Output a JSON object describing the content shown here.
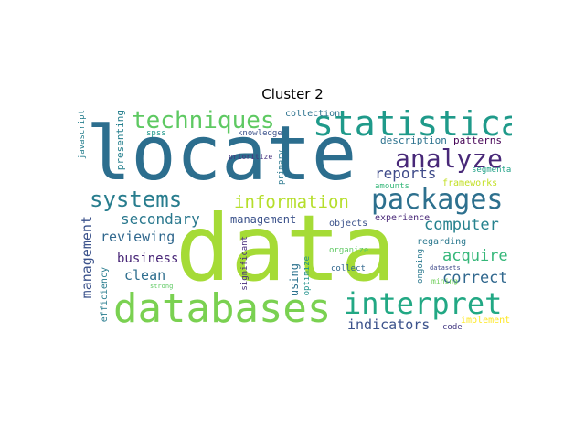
{
  "title": "Cluster 2",
  "words": [
    {
      "text": "data",
      "color": "#a5db36"
    },
    {
      "text": "locate",
      "color": "#2c6e8e"
    },
    {
      "text": "databases",
      "color": "#7ad151"
    },
    {
      "text": "statistical",
      "color": "#1f9a8a"
    },
    {
      "text": "interpret",
      "color": "#22a884"
    },
    {
      "text": "packages",
      "color": "#2d708e"
    },
    {
      "text": "techniques",
      "color": "#5ec962"
    },
    {
      "text": "analyze",
      "color": "#482878"
    },
    {
      "text": "systems",
      "color": "#287d8e"
    },
    {
      "text": "information",
      "color": "#b5de2b"
    },
    {
      "text": "computer",
      "color": "#26828e"
    },
    {
      "text": "reports",
      "color": "#3e4a89"
    },
    {
      "text": "acquire",
      "color": "#35b779"
    },
    {
      "text": "secondary",
      "color": "#2a788e"
    },
    {
      "text": "reviewing",
      "color": "#31688e"
    },
    {
      "text": "correct",
      "color": "#31688e"
    },
    {
      "text": "business",
      "color": "#482677"
    },
    {
      "text": "clean",
      "color": "#2e6e8e"
    },
    {
      "text": "indicators",
      "color": "#3b528b"
    },
    {
      "text": "management",
      "color": "#3b528b"
    },
    {
      "text": "description",
      "color": "#2c728e"
    },
    {
      "text": "patterns",
      "color": "#440154"
    },
    {
      "text": "frameworks",
      "color": "#c2df23"
    },
    {
      "text": "segmentation",
      "color": "#1fa187"
    },
    {
      "text": "regarding",
      "color": "#2a788e"
    },
    {
      "text": "experience",
      "color": "#482878"
    },
    {
      "text": "objects",
      "color": "#3b528b"
    },
    {
      "text": "amounts",
      "color": "#35b779"
    },
    {
      "text": "organize",
      "color": "#5ec962"
    },
    {
      "text": "collect",
      "color": "#31688e"
    },
    {
      "text": "mining",
      "color": "#6ece58"
    },
    {
      "text": "datasets",
      "color": "#3e4989"
    },
    {
      "text": "implement",
      "color": "#fde725"
    },
    {
      "text": "code",
      "color": "#443983"
    },
    {
      "text": "collection",
      "color": "#2c728e"
    },
    {
      "text": "spss",
      "color": "#1f988b"
    },
    {
      "text": "knowledge",
      "color": "#3b528b"
    },
    {
      "text": "prioritize",
      "color": "#46327e"
    },
    {
      "text": "strong",
      "color": "#b5de2b"
    },
    {
      "text": "javascript",
      "color": "#277f8e"
    },
    {
      "text": "presenting",
      "color": "#27808e"
    },
    {
      "text": "primary",
      "color": "#2a788e"
    },
    {
      "text": "significant",
      "color": "#472d7b"
    },
    {
      "text": "using",
      "color": "#2c728e"
    },
    {
      "text": "optimize",
      "color": "#21918c"
    },
    {
      "text": "efficiency",
      "color": "#287c8e"
    },
    {
      "text": "job",
      "color": "#5ec962"
    },
    {
      "text": "ongoing",
      "color": "#2a788e"
    },
    {
      "text": "strategies",
      "color": "#b5de2b"
    }
  ]
}
